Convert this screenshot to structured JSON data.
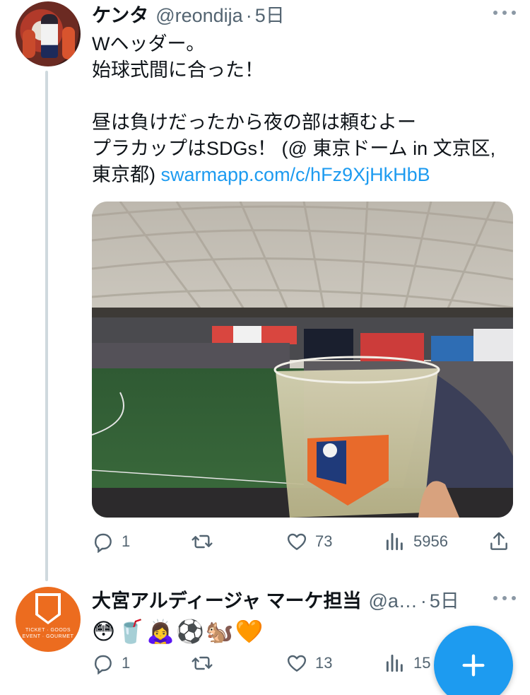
{
  "tweet1": {
    "name": "ケンタ",
    "handle": "@reondija",
    "separator": "·",
    "time": "5日",
    "text_main": "Wヘッダー。\n始球式間に合った！\n\n昼は負けだったから夜の部は頼むよー\nプラカップはSDGs！ (@ 東京ドーム in 文京区, 東京都) ",
    "link": "swarmapp.com/c/hFz9XjHkHbB",
    "stats": {
      "replies": "1",
      "retweets": "",
      "likes": "73",
      "views": "5956"
    }
  },
  "tweet2": {
    "name": "大宮アルディージャ マーケ担当",
    "handle": "@a…",
    "separator": "·",
    "time": "5日",
    "emojis": "😳🥤🙇‍♀️⚽🐿️🧡",
    "avatar_text": "TICKET · GOODS\nEVENT · GOURMET",
    "stats": {
      "replies": "1",
      "retweets": "",
      "likes": "13",
      "views": "15"
    }
  },
  "icons": {
    "reply": "reply-icon",
    "retweet": "retweet-icon",
    "like": "heart-icon",
    "views": "views-icon",
    "share": "share-icon",
    "more": "more-icon",
    "compose": "plus-icon"
  },
  "colors": {
    "link": "#1d9bf0",
    "muted": "#536471",
    "fab": "#1d9bf0",
    "club_orange": "#ec6c1f"
  }
}
